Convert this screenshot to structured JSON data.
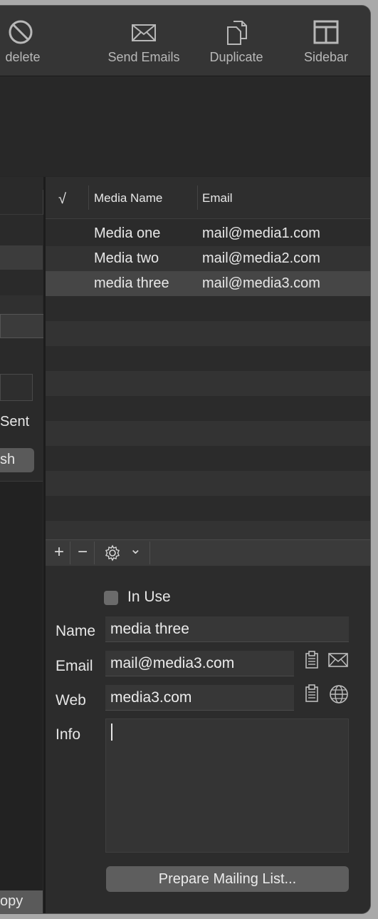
{
  "toolbar": {
    "delete_label": "delete",
    "send_emails_label": "Send Emails",
    "duplicate_label": "Duplicate",
    "sidebar_label": "Sidebar"
  },
  "left_pane": {
    "sent_label": "Sent",
    "button_label": "sh",
    "bottom_button_label": "opy"
  },
  "table": {
    "headers": {
      "check": "√",
      "name": "Media Name",
      "email": "Email"
    },
    "rows": [
      {
        "name": "Media one",
        "email": "mail@media1.com"
      },
      {
        "name": "Media two",
        "email": "mail@media2.com"
      },
      {
        "name": "media three",
        "email": "mail@media3.com"
      }
    ]
  },
  "table_toolbar": {
    "add": "+",
    "remove": "−",
    "chevron": "⌄"
  },
  "details": {
    "in_use_label": "In Use",
    "in_use_checked": false,
    "name_label": "Name",
    "name_value": "media three",
    "email_label": "Email",
    "email_value": "mail@media3.com",
    "web_label": "Web",
    "web_value": "media3.com",
    "info_label": "Info",
    "info_value": "",
    "prepare_button": "Prepare Mailing List..."
  },
  "icons": {
    "delete": "prohibited-icon",
    "send": "envelope-icon",
    "duplicate": "duplicate-icon",
    "sidebar": "sidebar-icon",
    "gear": "gear-icon",
    "clipboard": "clipboard-icon",
    "mail": "envelope-icon",
    "globe": "globe-icon"
  }
}
